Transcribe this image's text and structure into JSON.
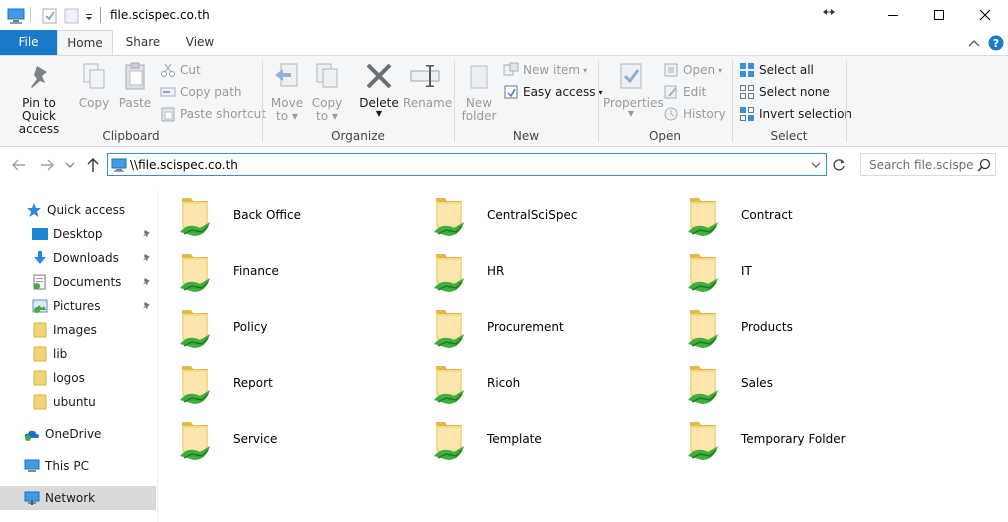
{
  "window": {
    "title": "file.scispec.co.th"
  },
  "tabs": [
    {
      "label": "File"
    },
    {
      "label": "Home"
    },
    {
      "label": "Share"
    },
    {
      "label": "View"
    }
  ],
  "ribbon": {
    "clipboard": {
      "label": "Clipboard",
      "pin": "Pin to Quick access",
      "pin_line1": "Pin to Quick",
      "pin_line2": "access",
      "copy": "Copy",
      "paste": "Paste",
      "cut": "Cut",
      "copy_path": "Copy path",
      "paste_shortcut": "Paste shortcut"
    },
    "organize": {
      "label": "Organize",
      "move_to_1": "Move",
      "move_to_2": "to",
      "copy_to_1": "Copy",
      "copy_to_2": "to",
      "delete": "Delete",
      "rename": "Rename"
    },
    "new": {
      "label": "New",
      "new_folder_1": "New",
      "new_folder_2": "folder",
      "new_item": "New item",
      "easy_access": "Easy access"
    },
    "open": {
      "label": "Open",
      "properties": "Properties",
      "open": "Open",
      "edit": "Edit",
      "history": "History"
    },
    "select": {
      "label": "Select",
      "select_all": "Select all",
      "select_none": "Select none",
      "invert_selection": "Invert selection"
    }
  },
  "address": {
    "path": "\\\\file.scispec.co.th",
    "search_placeholder": "Search file.scispe..."
  },
  "nav": {
    "quick_access": "Quick access",
    "items": [
      {
        "label": "Desktop",
        "pinned": true
      },
      {
        "label": "Downloads",
        "pinned": true
      },
      {
        "label": "Documents",
        "pinned": true
      },
      {
        "label": "Pictures",
        "pinned": true
      },
      {
        "label": "Images",
        "pinned": false
      },
      {
        "label": "lib",
        "pinned": false
      },
      {
        "label": "logos",
        "pinned": false
      },
      {
        "label": "ubuntu",
        "pinned": false
      }
    ],
    "onedrive": "OneDrive",
    "this_pc": "This PC",
    "network": "Network"
  },
  "folders": [
    "Back Office",
    "CentralSciSpec",
    "Contract",
    "Finance",
    "HR",
    "IT",
    "Policy",
    "Procurement",
    "Products",
    "Report",
    "Ricoh",
    "Sales",
    "Service",
    "Template",
    "Temporary Folder"
  ],
  "colors": {
    "accent": "#1979ca",
    "folder": "#f3d37a",
    "share": "#3fae3f"
  }
}
